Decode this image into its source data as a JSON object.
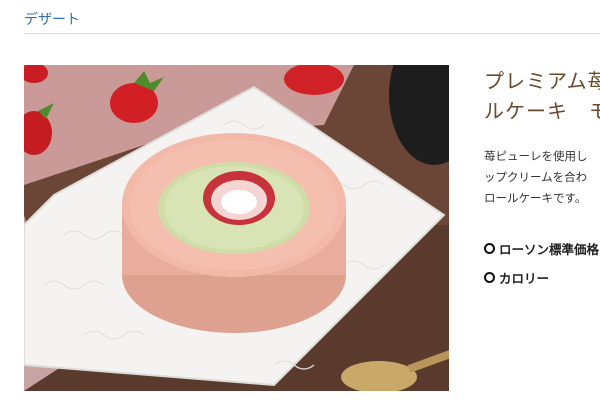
{
  "breadcrumb": {
    "category": "デザート"
  },
  "product": {
    "name_lines": [
      "プレミアム苺",
      "ルケーキ　モ"
    ],
    "description_lines": [
      "苺ピューレを使用し",
      "ップクリームを合わ",
      "ロールケーキです。"
    ],
    "image_icon": "strawberry-roll-cake-photo"
  },
  "info": {
    "price_label": "ローソン標準価格",
    "calorie_label": "カロリー",
    "bullet_icon": "ring-bullet-icon"
  },
  "colors": {
    "link": "#2f6fb3",
    "title": "#6b4a2b",
    "cake_sponge": "#f2b9a9",
    "cream": "#cfdca6"
  }
}
